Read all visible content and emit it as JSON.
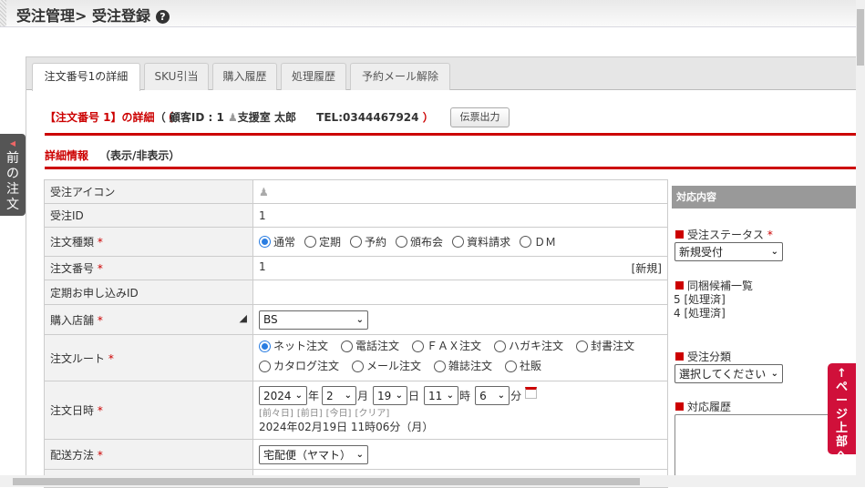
{
  "header": {
    "title": "受注管理> 受注登録",
    "help": "?"
  },
  "tabs": [
    "注文番号1の詳細",
    "SKU引当",
    "購入履歴",
    "処理履歴",
    "予約メール解除"
  ],
  "info": {
    "order_label": "【注文番号 1】の詳細",
    "customer": "（ 顧客ID : 1",
    "customer_name": "支援室 太郎",
    "tel": "TEL:0344467924",
    "close": "）",
    "slip_button": "伝票出力"
  },
  "section": {
    "title": "詳細情報",
    "toggle": "（表示/非表示）"
  },
  "form": {
    "icon_label": "受注アイコン",
    "id_label": "受注ID",
    "id_value": "1",
    "type_label": "注文種類",
    "types": [
      "通常",
      "定期",
      "予約",
      "頒布会",
      "資料請求",
      "ＤＭ"
    ],
    "number_label": "注文番号",
    "number_value": "1",
    "number_new": "[新規]",
    "sub_label": "定期お申し込みID",
    "shop_label": "購入店舗",
    "shop_value": "BS",
    "route_label": "注文ルート",
    "routes": [
      "ネット注文",
      "電話注文",
      "ＦＡＸ注文",
      "ハガキ注文",
      "封書注文",
      "カタログ注文",
      "メール注文",
      "雑誌注文",
      "社販"
    ],
    "date_label": "注文日時",
    "year": "2024",
    "year_unit": "年",
    "month": "2",
    "month_unit": "月",
    "day": "19",
    "day_unit": "日",
    "hour": "11",
    "hour_unit": "時",
    "minute": "6",
    "minute_unit": "分",
    "quick": [
      "[前々日]",
      "[前日]",
      "[今日]",
      "[クリア]"
    ],
    "date_text": "2024年02月19日 11時06分（月）",
    "delivery_label": "配送方法",
    "delivery_value": "宅配便（ヤマト）",
    "req": "*"
  },
  "right": {
    "header": "対応内容",
    "status_label": "受注ステータス",
    "status_value": "新規受付",
    "bundle_label": "同梱候補一覧",
    "bundle": [
      "5 [処理済]",
      "4 [処理済]"
    ],
    "category_label": "受注分類",
    "category_value": "選択してください",
    "history_label": "対応履歴"
  },
  "side": {
    "prev": [
      "前",
      "の",
      "注",
      "文"
    ],
    "top": [
      "↑",
      "ペ",
      "ー",
      "ジ",
      "上",
      "部",
      "へ"
    ]
  }
}
